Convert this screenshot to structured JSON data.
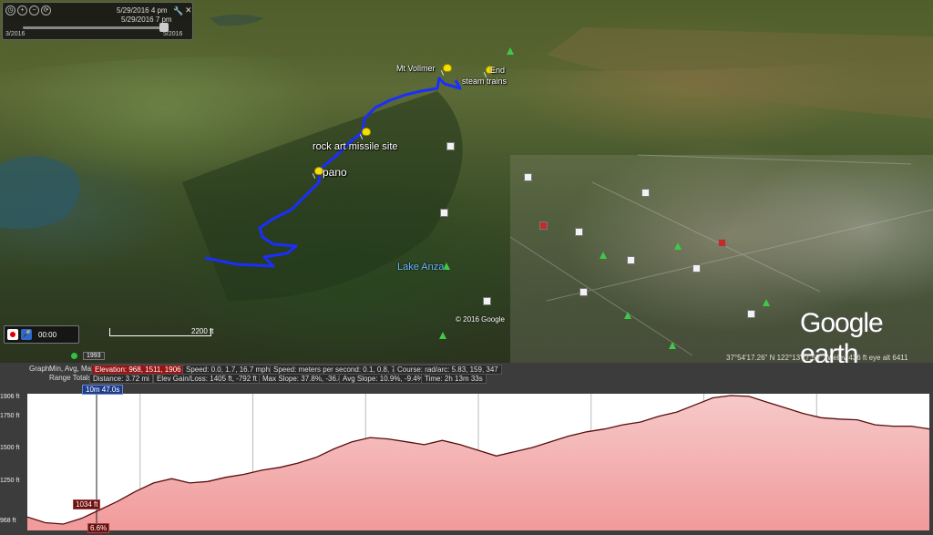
{
  "time_slider": {
    "date_top": "5/29/2016 4 pm",
    "date_bottom": "5/29/2016 7 pm",
    "range_start": "3/2016",
    "range_end": "5/2016"
  },
  "map": {
    "placemarks": [
      "Mt Vollmer",
      "End",
      "steam trains",
      "rock art missile site",
      "pano"
    ],
    "lake_label": "Lake Anza",
    "copyright": "© 2016 Google",
    "logo": "Google earth",
    "scale_label": "2200 ft",
    "status": "37°54'17.26\" N 122°13'27.50\" W elev 436 ft eye alt 6411",
    "tour_time": "00:00",
    "imagery_year": "1993",
    "track_color": "#1a2eff"
  },
  "profile": {
    "row1": {
      "graph_label": "Graph:",
      "graph_modes": "Min, Avg, Max",
      "elevation": "Elevation: 968, 1511, 1906 ft",
      "speed": "Speed: 0.0, 1.7, 16.7 mph",
      "speed_unit": "Speed: meters per second: 0.1, 0.8, 7.24",
      "course": "Course: rad/arc: 5.83, 159, 347"
    },
    "row2": {
      "range_label": "Range Totals:",
      "distance": "Distance: 3.72 mi",
      "elev_gain": "Elev Gain/Loss: 1405 ft, -792 ft",
      "max_slope": "Max Slope: 37.8%, -36.8%",
      "avg_slope": "Avg Slope: 10.9%, -9.4%",
      "time": "Time: 2h 13m 33s"
    },
    "y_ticks": [
      "1906 ft",
      "1750 ft",
      "1500 ft",
      "1250 ft",
      "968 ft"
    ],
    "cursor_time": "10m 47.0s",
    "cursor_elev": "1034 ft",
    "cursor_slope": "6.6%",
    "chart_data": {
      "type": "area",
      "ylim": [
        968,
        1906
      ],
      "x": [
        0,
        2,
        4,
        6,
        8,
        10,
        12,
        14,
        16,
        18,
        20,
        22,
        24,
        26,
        28,
        30,
        32,
        34,
        36,
        38,
        40,
        42,
        44,
        46,
        48,
        50,
        52,
        54,
        56,
        58,
        60,
        62,
        64,
        66,
        68,
        70,
        72,
        74,
        76,
        78,
        80,
        82,
        84,
        86,
        88,
        90,
        92,
        94,
        96,
        98,
        100
      ],
      "values": [
        1050,
        1010,
        1000,
        1040,
        1100,
        1160,
        1230,
        1290,
        1320,
        1290,
        1300,
        1330,
        1350,
        1380,
        1400,
        1430,
        1470,
        1530,
        1580,
        1610,
        1600,
        1580,
        1560,
        1590,
        1560,
        1520,
        1480,
        1510,
        1540,
        1580,
        1620,
        1650,
        1670,
        1700,
        1720,
        1760,
        1790,
        1840,
        1890,
        1906,
        1900,
        1860,
        1820,
        1780,
        1750,
        1740,
        1735,
        1700,
        1690,
        1690,
        1670
      ]
    }
  }
}
